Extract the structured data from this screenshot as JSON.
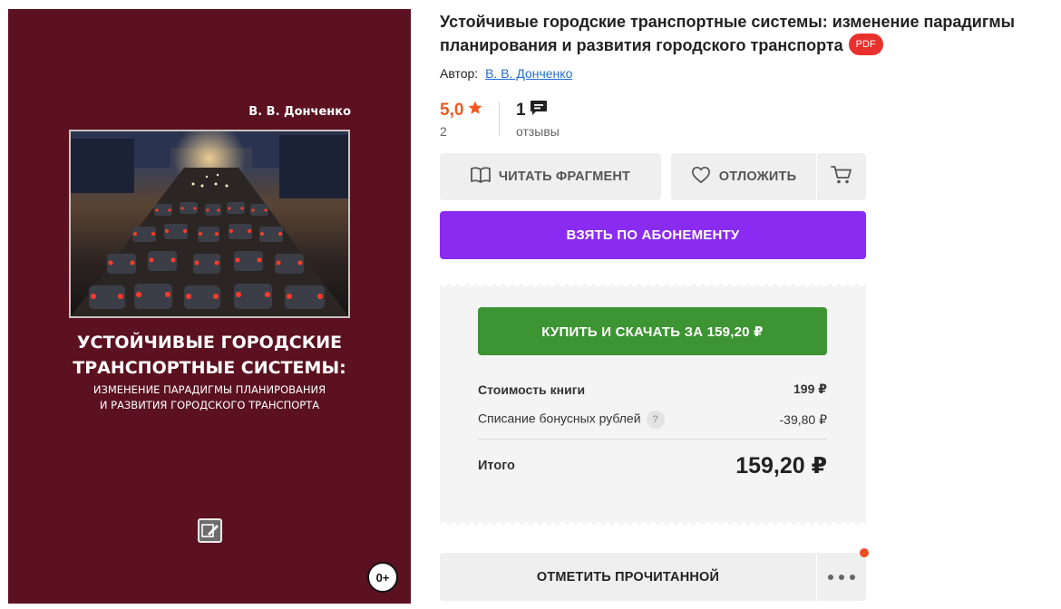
{
  "book": {
    "title": "Устойчивые городские транспортные системы: изменение парадигмы планирования и развития городского транспорта",
    "format_badge": "PDF",
    "author_label": "Автор:",
    "author_name": "В. В. Донченко"
  },
  "cover": {
    "author": "В. В. Донченко",
    "title_line1": "УСТОЙЧИВЫЕ ГОРОДСКИЕ",
    "title_line2": "ТРАНСПОРТНЫЕ СИСТЕМЫ:",
    "subtitle_line1": "ИЗМЕНЕНИЕ ПАРАДИГМЫ ПЛАНИРОВАНИЯ",
    "subtitle_line2": "И РАЗВИТИЯ ГОРОДСКОГО ТРАНСПОРТА",
    "age_rating": "0+",
    "background_color": "#5b111f"
  },
  "rating": {
    "value": "5,0",
    "count": "2",
    "reviews_count": "1",
    "reviews_label": "отзывы"
  },
  "actions": {
    "read_fragment": "ЧИТАТЬ ФРАГМЕНТ",
    "defer": "ОТЛОЖИТЬ",
    "subscribe": "ВЗЯТЬ ПО АБОНЕМЕНТУ",
    "buy": "КУПИТЬ И СКАЧАТЬ ЗА 159,20 ₽",
    "mark_read": "ОТМЕТИТЬ ПРОЧИТАННОЙ"
  },
  "pricing": {
    "book_cost_label": "Стоимость книги",
    "book_cost_value": "199 ₽",
    "bonus_label": "Списание бонусных рублей",
    "bonus_help": "?",
    "bonus_value": "-39,80 ₽",
    "total_label": "Итого",
    "total_value": "159,20 ₽"
  },
  "colors": {
    "accent_orange": "#f05a22",
    "subscribe_purple": "#8a2bf2",
    "buy_green": "#3d9432",
    "pdf_red": "#e8312c",
    "link_blue": "#1f6fd6"
  }
}
